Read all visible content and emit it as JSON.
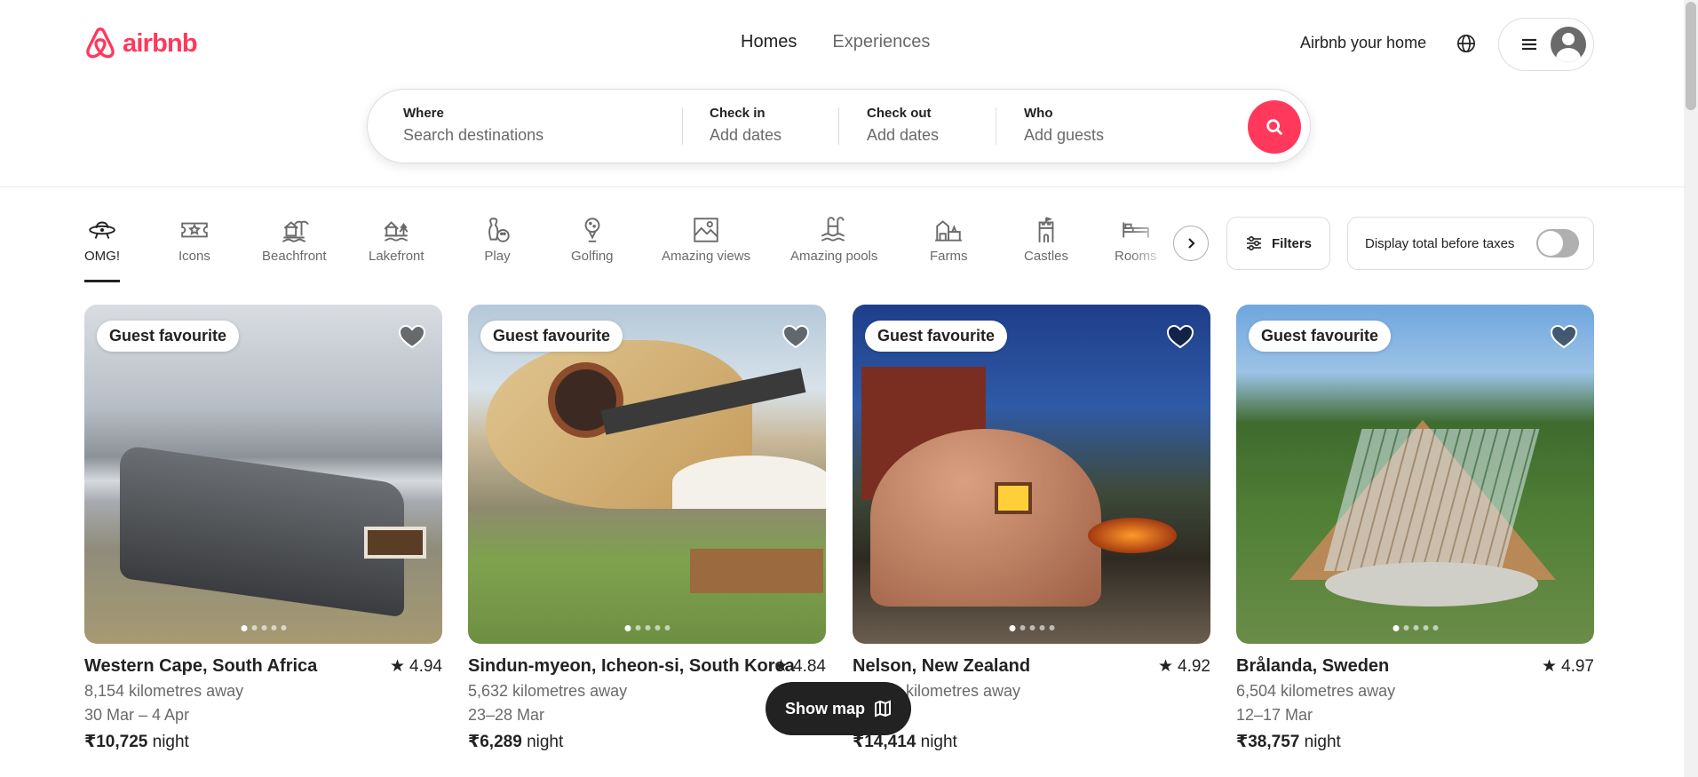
{
  "brand": {
    "name": "airbnb",
    "color": "#ff385c"
  },
  "nav": {
    "homes": "Homes",
    "experiences": "Experiences"
  },
  "header_right": {
    "host_link": "Airbnb your home",
    "globe_icon": "globe-icon",
    "menu_icon": "hamburger-icon",
    "avatar_icon": "user-avatar-icon"
  },
  "search": {
    "where_label": "Where",
    "where_placeholder": "Search destinations",
    "checkin_label": "Check in",
    "checkin_placeholder": "Add dates",
    "checkout_label": "Check out",
    "checkout_placeholder": "Add dates",
    "who_label": "Who",
    "who_placeholder": "Add guests",
    "button_icon": "search-icon"
  },
  "categories": [
    {
      "label": "OMG!",
      "icon": "ufo-icon",
      "active": true
    },
    {
      "label": "Icons",
      "icon": "ticket-icon"
    },
    {
      "label": "Beachfront",
      "icon": "beach-icon"
    },
    {
      "label": "Lakefront",
      "icon": "lake-icon"
    },
    {
      "label": "Play",
      "icon": "bowling-icon"
    },
    {
      "label": "Golfing",
      "icon": "golf-icon"
    },
    {
      "label": "Amazing views",
      "icon": "view-icon"
    },
    {
      "label": "Amazing pools",
      "icon": "pool-icon"
    },
    {
      "label": "Farms",
      "icon": "farm-icon"
    },
    {
      "label": "Castles",
      "icon": "castle-icon"
    },
    {
      "label": "Rooms",
      "icon": "bed-icon"
    }
  ],
  "filters": {
    "label": "Filters",
    "icon": "sliders-icon"
  },
  "taxes": {
    "label": "Display total before taxes",
    "enabled": false
  },
  "listings": [
    {
      "badge": "Guest favourite",
      "title": "Western Cape, South Africa",
      "rating": "4.94",
      "distance": "8,154 kilometres away",
      "dates": "30 Mar – 4 Apr",
      "price": "₹10,725",
      "price_unit": "night"
    },
    {
      "badge": "Guest favourite",
      "title": "Sindun-myeon, Icheon-si, South Korea",
      "rating": "4.84",
      "distance": "5,632 kilometres away",
      "dates": "23–28 Mar",
      "price": "₹6,289",
      "price_unit": "night"
    },
    {
      "badge": "Guest favourite",
      "title": "Nelson, New Zealand",
      "rating": "4.92",
      "distance": "kilometres away",
      "dates": "",
      "price": "₹14,414",
      "price_unit": "night"
    },
    {
      "badge": "Guest favourite",
      "title": "Brålanda, Sweden",
      "rating": "4.97",
      "distance": "6,504 kilometres away",
      "dates": "12–17 Mar",
      "price": "₹38,757",
      "price_unit": "night"
    }
  ],
  "show_map": {
    "label": "Show map",
    "icon": "map-icon"
  }
}
